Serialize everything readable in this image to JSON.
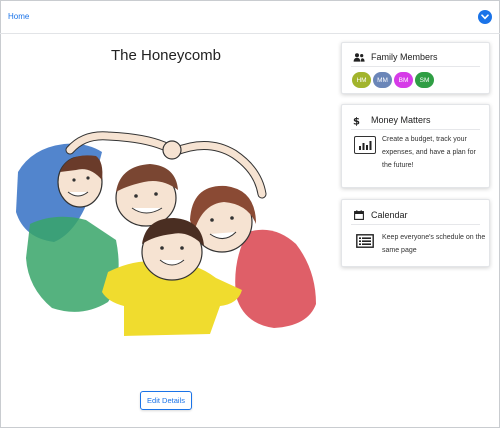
{
  "nav": {
    "home_label": "Home",
    "menu_icon": "chevron-down-icon"
  },
  "page": {
    "title": "The Honeycomb",
    "edit_label": "Edit Details"
  },
  "family": {
    "title": "Family Members",
    "icon": "users-icon",
    "members": [
      {
        "initials": "HM",
        "color": "#a2b42c"
      },
      {
        "initials": "MM",
        "color": "#6b86b8"
      },
      {
        "initials": "BM",
        "color": "#d63be8"
      },
      {
        "initials": "SM",
        "color": "#2f9e44"
      }
    ]
  },
  "money": {
    "title": "Money Matters",
    "icon": "dollar-icon",
    "feature_icon": "bar-chart-icon",
    "text": "Create a budget, track your expenses, and have a plan for the future!"
  },
  "calendar": {
    "title": "Calendar",
    "icon": "calendar-icon",
    "feature_icon": "list-icon",
    "text": "Keep everyone's schedule on the same page"
  },
  "colors": {
    "accent": "#1a73e8"
  }
}
